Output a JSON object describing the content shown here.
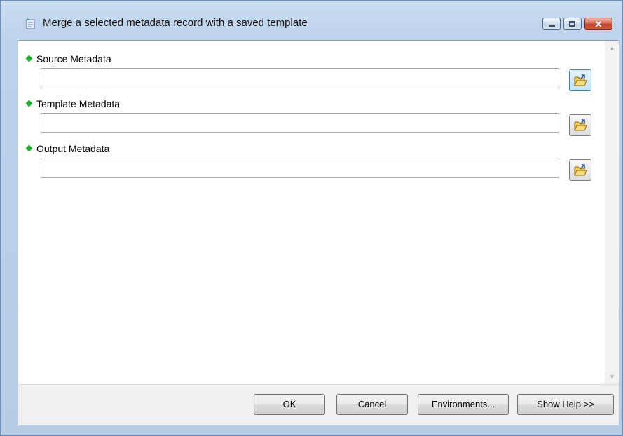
{
  "window": {
    "title": "Merge a selected metadata record with a saved template",
    "close_glyph": "✕"
  },
  "parameters": [
    {
      "label": "Source Metadata",
      "value": "",
      "required": true
    },
    {
      "label": "Template Metadata",
      "value": "",
      "required": true
    },
    {
      "label": "Output Metadata",
      "value": "",
      "required": true
    }
  ],
  "buttons": {
    "ok": "OK",
    "cancel": "Cancel",
    "environments": "Environments...",
    "show_help": "Show Help >>"
  },
  "icons": {
    "app": "metadata-tool-icon",
    "browse": "open-folder-icon",
    "required": "green-diamond-icon"
  },
  "colors": {
    "required_dot": "#19b52c",
    "title_bar": "#c9dcf0",
    "close_button": "#c0452a"
  }
}
